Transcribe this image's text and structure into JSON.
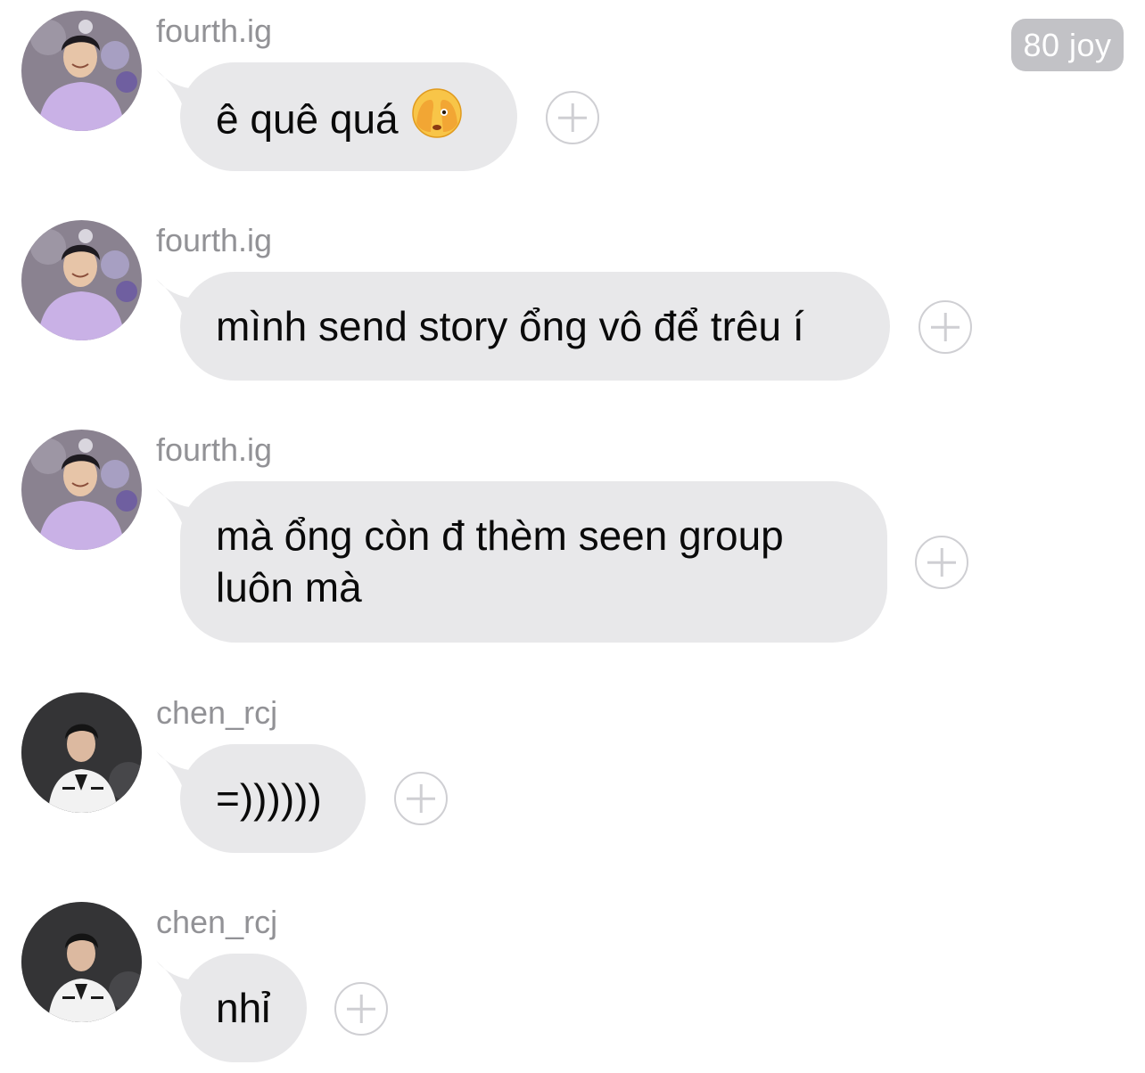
{
  "header": {
    "badge_label": "80 joy"
  },
  "messages": [
    {
      "sender": "fourth.ig",
      "lines": [
        "ê quê quá"
      ],
      "emoji": "shy-face-hand-over-eyes"
    },
    {
      "sender": "fourth.ig",
      "lines": [
        "mình send story ổng vô để trêu í"
      ]
    },
    {
      "sender": "fourth.ig",
      "lines": [
        "mà ổng còn đ thèm seen group",
        "luôn mà"
      ]
    },
    {
      "sender": "chen_rcj",
      "lines": [
        "=))))))"
      ]
    },
    {
      "sender": "chen_rcj",
      "lines": [
        "nhỉ"
      ]
    }
  ],
  "colors": {
    "bubble": "#e8e8ea",
    "sender_text": "#929296",
    "badge_bg": "#c2c2c6",
    "avatar_fourth_bg": "#8a8290",
    "avatar_chen_bg": "#2e2e30",
    "hoodie": "#c9b1e6"
  }
}
